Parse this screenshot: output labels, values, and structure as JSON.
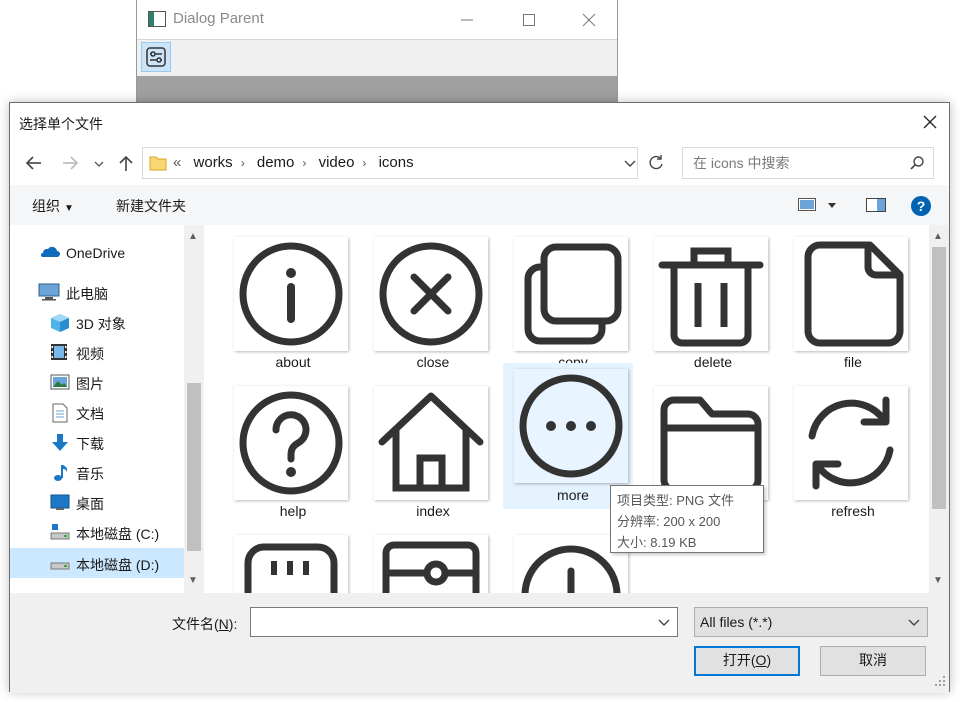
{
  "parent_window": {
    "title": "Dialog Parent"
  },
  "dialog": {
    "title": "选择单个文件"
  },
  "address": {
    "overflow": "«",
    "crumbs": [
      "works",
      "demo",
      "video",
      "icons"
    ]
  },
  "search": {
    "placeholder": "在 icons 中搜索"
  },
  "command_bar": {
    "organize": "组织",
    "new_folder": "新建文件夹"
  },
  "nav_pane": {
    "items": [
      {
        "label": "OneDrive",
        "icon": "onedrive-icon"
      },
      {
        "label": "此电脑",
        "icon": "computer-icon"
      },
      {
        "label": "3D 对象",
        "icon": "3d-objects-icon"
      },
      {
        "label": "视频",
        "icon": "video-icon"
      },
      {
        "label": "图片",
        "icon": "pictures-icon"
      },
      {
        "label": "文档",
        "icon": "documents-icon"
      },
      {
        "label": "下载",
        "icon": "download-icon"
      },
      {
        "label": "音乐",
        "icon": "music-icon"
      },
      {
        "label": "桌面",
        "icon": "desktop-icon"
      },
      {
        "label": "本地磁盘 (C:)",
        "icon": "drive-c-icon"
      },
      {
        "label": "本地磁盘 (D:)",
        "icon": "drive-d-icon",
        "selected": true
      }
    ]
  },
  "files": [
    {
      "name": "about",
      "icon": "info-icon"
    },
    {
      "name": "close",
      "icon": "close-circle-icon"
    },
    {
      "name": "copy",
      "icon": "copy-icon"
    },
    {
      "name": "delete",
      "icon": "trash-icon"
    },
    {
      "name": "file",
      "icon": "file-icon"
    },
    {
      "name": "help",
      "icon": "help-icon"
    },
    {
      "name": "index",
      "icon": "home-icon"
    },
    {
      "name": "more",
      "icon": "more-icon",
      "hovered": true
    },
    {
      "name": "",
      "icon": "folder-icon"
    },
    {
      "name": "refresh",
      "icon": "refresh-icon"
    }
  ],
  "tooltip": {
    "type": "项目类型: PNG 文件",
    "resolution": "分辨率: 200 x 200",
    "size": "大小: 8.19 KB"
  },
  "bottom": {
    "filename_label": "文件名(",
    "filename_key": "N",
    "filename_label_end": "):",
    "filename_value": "",
    "filter_value": "All files (*.*)",
    "open_label": "打开(",
    "open_key": "O",
    "open_label_end": ")",
    "cancel_label": "取消"
  },
  "colors": {
    "accent": "#0078d7",
    "selection": "#cce8ff",
    "hover": "#e5f3ff"
  }
}
